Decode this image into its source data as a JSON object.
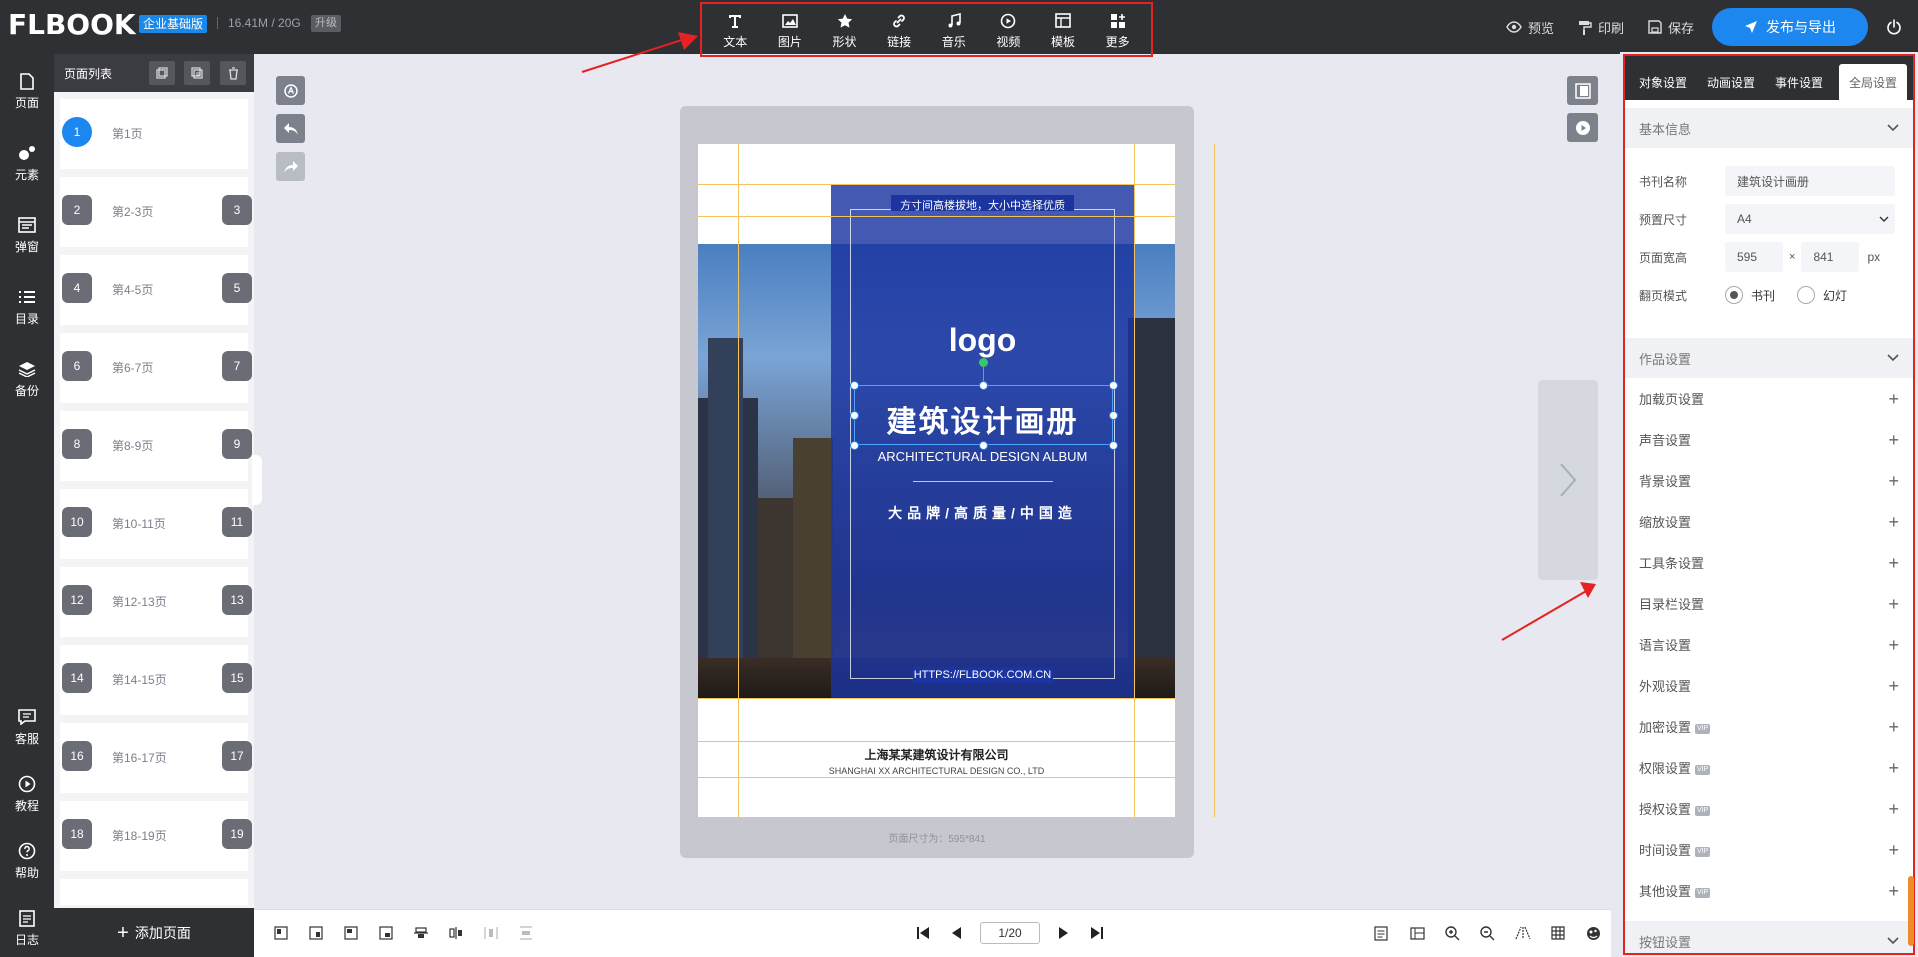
{
  "app": {
    "logo": "FLBOOK",
    "plan_badge": "企业基础版",
    "storage": "16.41M / 20G",
    "upgrade": "升级"
  },
  "toolbar": {
    "items": [
      {
        "label": "文本",
        "icon": "text-icon"
      },
      {
        "label": "图片",
        "icon": "image-icon"
      },
      {
        "label": "形状",
        "icon": "star-icon"
      },
      {
        "label": "链接",
        "icon": "link-icon"
      },
      {
        "label": "音乐",
        "icon": "music-icon"
      },
      {
        "label": "视频",
        "icon": "video-icon"
      },
      {
        "label": "模板",
        "icon": "template-icon"
      },
      {
        "label": "更多",
        "icon": "more-icon"
      }
    ]
  },
  "actions": {
    "preview": "预览",
    "print": "印刷",
    "save": "保存",
    "publish": "发布与导出"
  },
  "leftnav": {
    "items": [
      {
        "label": "页面",
        "icon": "page-icon"
      },
      {
        "label": "元素",
        "icon": "elements-icon"
      },
      {
        "label": "弹窗",
        "icon": "popup-icon"
      },
      {
        "label": "目录",
        "icon": "toc-icon"
      },
      {
        "label": "备份",
        "icon": "layers-icon"
      },
      {
        "label": "客服",
        "icon": "chat-icon"
      },
      {
        "label": "教程",
        "icon": "play-icon"
      },
      {
        "label": "帮助",
        "icon": "help-icon"
      },
      {
        "label": "日志",
        "icon": "log-icon"
      }
    ]
  },
  "pagelist": {
    "title": "页面列表",
    "add_page": "添加页面",
    "pages": [
      {
        "label": "第1页",
        "left": "1",
        "right": ""
      },
      {
        "label": "第2-3页",
        "left": "2",
        "right": "3"
      },
      {
        "label": "第4-5页",
        "left": "4",
        "right": "5"
      },
      {
        "label": "第6-7页",
        "left": "6",
        "right": "7"
      },
      {
        "label": "第8-9页",
        "left": "8",
        "right": "9"
      },
      {
        "label": "第10-11页",
        "left": "10",
        "right": "11"
      },
      {
        "label": "第12-13页",
        "left": "12",
        "right": "13"
      },
      {
        "label": "第14-15页",
        "left": "14",
        "right": "15"
      },
      {
        "label": "第16-17页",
        "left": "16",
        "right": "17"
      },
      {
        "label": "第18-19页",
        "left": "18",
        "right": "19"
      }
    ]
  },
  "canvas": {
    "slogan": "方寸间高楼拔地，大小中选择优质",
    "logo": "logo",
    "title": "建筑设计画册",
    "subtitle": "ARCHITECTURAL DESIGN ALBUM",
    "tagline": "大品牌/高质量/中国造",
    "url": "HTTPS://FLBOOK.COM.CN",
    "company_cn": "上海某某建筑设计有限公司",
    "company_en": "SHANGHAI XX ARCHITECTURAL DESIGN CO., LTD",
    "page_size": "页面尺寸为：595*841"
  },
  "pager": {
    "current": "1/20"
  },
  "rpanel": {
    "tabs": [
      "对象设置",
      "动画设置",
      "事件设置",
      "全局设置"
    ],
    "basic_title": "基本信息",
    "book_name_label": "书刊名称",
    "book_name": "建筑设计画册",
    "preset_label": "预置尺寸",
    "preset_value": "A4",
    "size_label": "页面宽高",
    "width": "595",
    "height": "841",
    "times": "×",
    "unit": "px",
    "flip_label": "翻页模式",
    "flip_book": "书刊",
    "flip_slide": "幻灯",
    "works_title": "作品设置",
    "settings": [
      {
        "label": "加载页设置",
        "vip": ""
      },
      {
        "label": "声音设置",
        "vip": ""
      },
      {
        "label": "背景设置",
        "vip": ""
      },
      {
        "label": "缩放设置",
        "vip": ""
      },
      {
        "label": "工具条设置",
        "vip": ""
      },
      {
        "label": "目录栏设置",
        "vip": ""
      },
      {
        "label": "语言设置",
        "vip": ""
      },
      {
        "label": "外观设置",
        "vip": ""
      },
      {
        "label": "加密设置",
        "vip": "VIP"
      },
      {
        "label": "权限设置",
        "vip": "VIP"
      },
      {
        "label": "授权设置",
        "vip": "VIP"
      },
      {
        "label": "时间设置",
        "vip": "VIP"
      },
      {
        "label": "其他设置",
        "vip": "VIP"
      }
    ],
    "button_title": "按钮设置"
  },
  "colors": {
    "topbar": "#2f3033",
    "accent": "#1d87f0",
    "highlight": "#e52222",
    "cover_blue": "#1b34a0"
  }
}
